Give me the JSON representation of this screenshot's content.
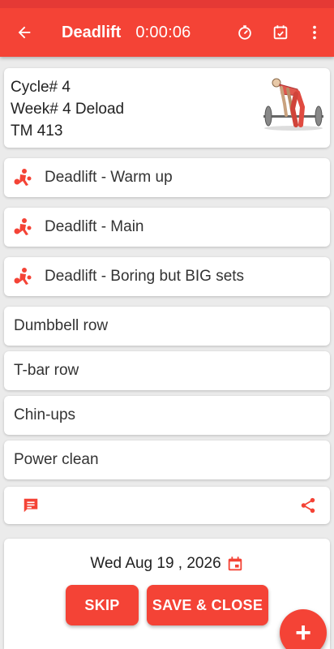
{
  "colors": {
    "accent": "#f44336",
    "accent_dark": "#e53935",
    "background": "#ebebeb"
  },
  "toolbar": {
    "title": "Deadlift",
    "timer": "0:00:06",
    "icons": [
      "back-arrow-icon",
      "stopwatch-icon",
      "calendar-check-icon",
      "more-vert-icon"
    ]
  },
  "info": {
    "cycle": "Cycle# 4",
    "week": "Week# 4 Deload",
    "tm": "TM 413",
    "image": "deadlift-figure"
  },
  "exercises": [
    {
      "label": "Deadlift - Warm up",
      "icon": "lifter-icon"
    },
    {
      "label": "Deadlift - Main",
      "icon": "lifter-icon"
    },
    {
      "label": "Deadlift - Boring but BIG sets",
      "icon": "lifter-icon"
    },
    {
      "label": "Dumbbell row",
      "icon": ""
    },
    {
      "label": "T-bar row",
      "icon": ""
    },
    {
      "label": "Chin-ups",
      "icon": ""
    },
    {
      "label": "Power clean",
      "icon": ""
    }
  ],
  "tools": {
    "left_icon": "comment-icon",
    "right_icon": "share-icon"
  },
  "footer": {
    "date": "Wed Aug 19 , 2026",
    "skip_label": "SKIP",
    "save_label": "SAVE & CLOSE"
  },
  "fab": {
    "label": "+"
  }
}
